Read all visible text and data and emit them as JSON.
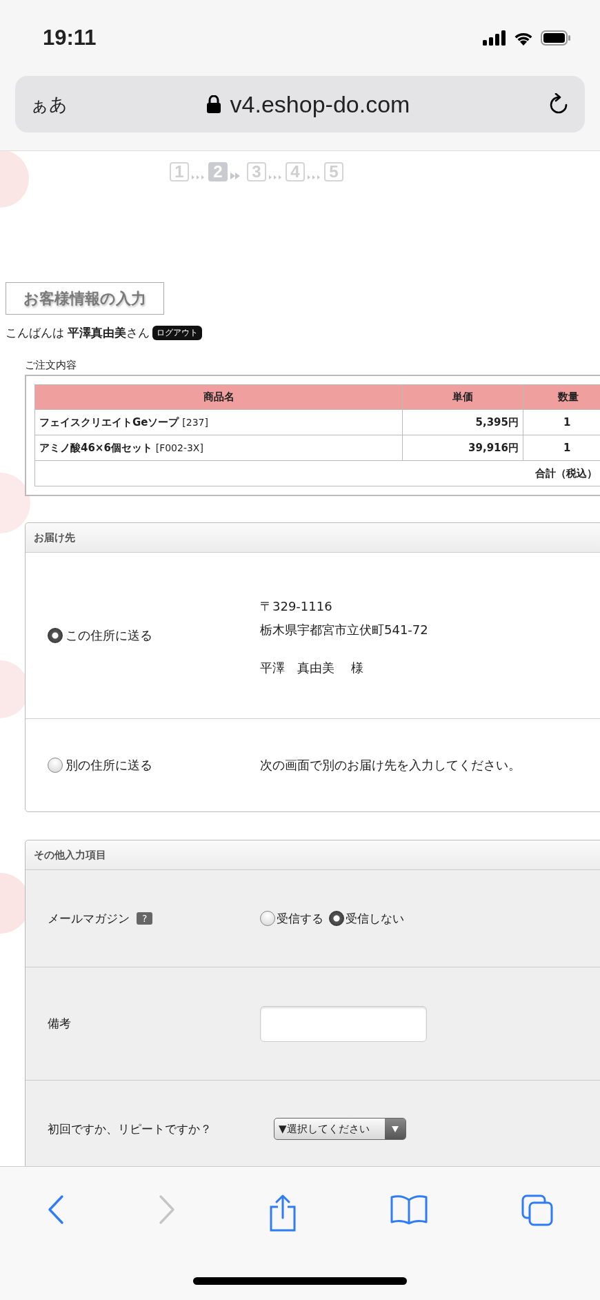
{
  "status_bar": {
    "time": "19:11"
  },
  "address_bar": {
    "text_size": "ぁあ",
    "url": "v4.eshop-do.com"
  },
  "steps": [
    {
      "label": "1",
      "selected": false
    },
    {
      "label": "2",
      "selected": true
    },
    {
      "label": "3",
      "selected": false
    },
    {
      "label": "4",
      "selected": false
    },
    {
      "label": "5",
      "selected": false
    }
  ],
  "page_title": "お客様情報の入力",
  "greeting": {
    "prefix": "こんばんは",
    "name": "平澤真由美",
    "suffix": "さん",
    "logout": "ログアウト"
  },
  "order": {
    "heading": "ご注文内容",
    "columns": [
      "商品名",
      "単価",
      "数量"
    ],
    "rows": [
      {
        "name": "フェイスクリエイトGeソープ",
        "code": "[237]",
        "price": "5,395円",
        "quantity": "1"
      },
      {
        "name": "アミノ酸46×6個セット",
        "code": "[F002-3X]",
        "price": "39,916円",
        "quantity": "1"
      }
    ],
    "total_label": "合計（税込）"
  },
  "delivery": {
    "title": "お届け先",
    "options": [
      {
        "kind": "address",
        "label": "この住所に送る",
        "selected": true,
        "lines": [
          "〒329-1116",
          "栃木県宇都宮市立伏町541-72"
        ],
        "recipient": "平澤　真由美　 様"
      },
      {
        "kind": "note",
        "label": "別の住所に送る",
        "selected": false,
        "note": "次の画面で別のお届け先を入力してください。"
      }
    ]
  },
  "other": {
    "title": "その他入力項目",
    "rows": [
      {
        "kind": "radio",
        "label": "メールマガジン",
        "help": "?",
        "options": [
          {
            "label": "受信する",
            "selected": false
          },
          {
            "label": "受信しない",
            "selected": true
          }
        ]
      },
      {
        "kind": "text",
        "label": "備考"
      },
      {
        "kind": "select",
        "label": "初回ですか、リピートですか？",
        "value": "▼選択してください"
      }
    ]
  },
  "toolbar": {
    "back": {
      "disabled": false
    },
    "forward": {
      "disabled": true
    }
  }
}
